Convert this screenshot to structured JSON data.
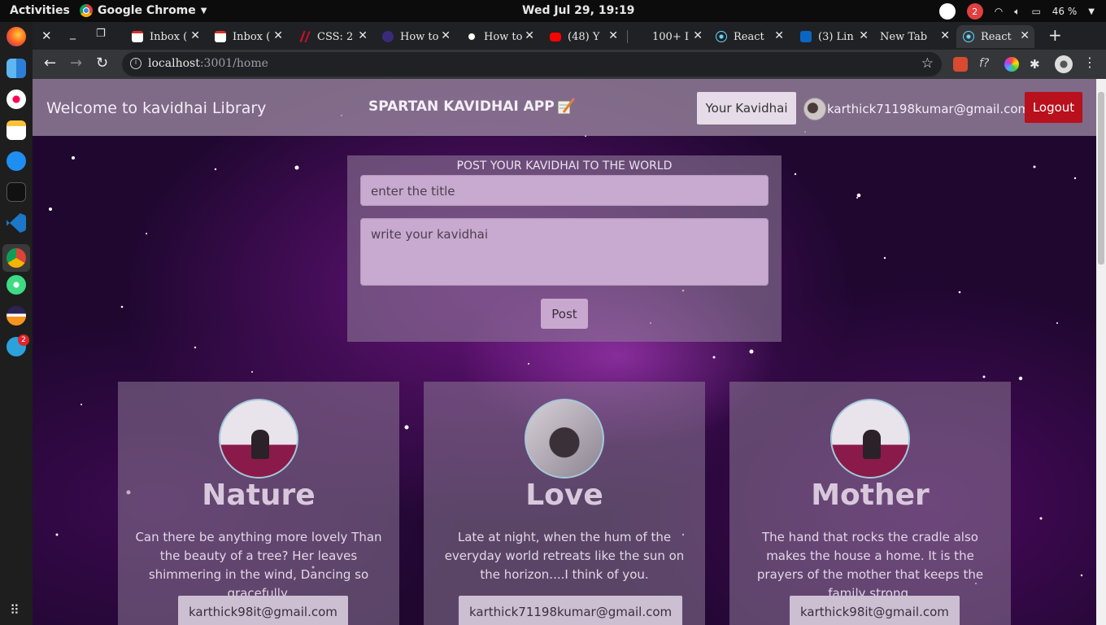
{
  "desktop": {
    "activities": "Activities",
    "app_menu": "Google Chrome",
    "clock": "Wed Jul 29, 19:19",
    "notification_count": "2",
    "battery": "46 %",
    "dock_badge": "2"
  },
  "browser": {
    "tabs": [
      {
        "title": "Inbox (",
        "icon": "gmail-icon"
      },
      {
        "title": "Inbox (",
        "icon": "gmail-icon"
      },
      {
        "title": "CSS: 2",
        "icon": "css-icon"
      },
      {
        "title": "How to",
        "icon": "apollo-icon"
      },
      {
        "title": "How to",
        "icon": "site-icon"
      },
      {
        "title": "(48) Y",
        "icon": "youtube-icon"
      },
      {
        "title": "100+ I",
        "icon": "blank-icon"
      },
      {
        "title": "React",
        "icon": "react-icon"
      },
      {
        "title": "(3) Lin",
        "icon": "linkedin-icon"
      },
      {
        "title": "New Tab",
        "icon": "newtab-icon"
      },
      {
        "title": "React",
        "icon": "react-icon"
      }
    ],
    "url_host": "localhost",
    "url_rest": ":3001/home"
  },
  "app": {
    "brand": "Welcome to kavidhai Library",
    "title": "SPARTAN KAVIDHAI APP",
    "your_kavidhai_label": "Your Kavidhai",
    "user_email": "karthick71198kumar@gmail.com",
    "logout_label": "Logout",
    "colors": {
      "logout": "#b8101c",
      "panel": "#c8a9cf"
    }
  },
  "post_form": {
    "heading": "POST YOUR KAVIDHAI TO THE WORLD",
    "title_placeholder": "enter the title",
    "body_placeholder": "write your kavidhai",
    "post_label": "Post"
  },
  "cards": [
    {
      "title": "Nature",
      "text": "Can there be anything more lovely Than the beauty of a tree? Her leaves shimmering in the wind, Dancing so gracefully.",
      "author": "karthick98it@gmail.com"
    },
    {
      "title": "Love",
      "text": "Late at night, when the hum of the everyday world retreats like the sun on the horizon....I think of you.",
      "author": "karthick71198kumar@gmail.com"
    },
    {
      "title": "Mother",
      "text": "The hand that rocks the cradle also makes the house a home. It is the prayers of the mother that keeps the family strong.",
      "author": "karthick98it@gmail.com"
    }
  ]
}
